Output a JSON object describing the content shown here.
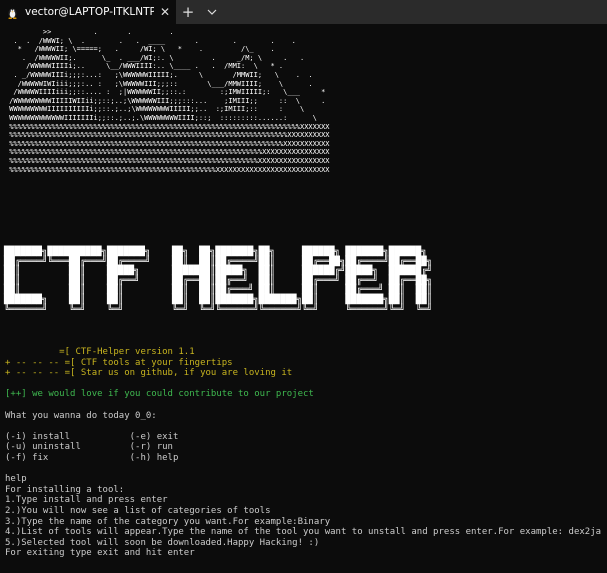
{
  "window": {
    "tab_title": "vector@LAPTOP-ITKLNTPG: /mi",
    "close_label": "✕",
    "new_tab_label": "+",
    "dropdown_label": "⌄"
  },
  "ascii_art": [
    "         >>          .       .         .",
    "  .  .  /WWWI; \\  .        .   .  ____       .        .        .    .",
    "   *   /WWWWII; \\=====;   .     /WI; \\   *    .         /\\_    .",
    "    .  /WWWWWII;.      \\_  . ___/WI;:. \\         .     _/M; \\     .   .",
    "     /WWWWWIIIIi;..     \\__/WWWIIII:.. \\____ .   .  /MMI:  \\   * .",
    "  . _/WWWWWIIIi;;;:...:   ;\\WWWWWWIIIII;.     \\       /MMWII;   \\    .  .",
    "   /WWWWWIWIiii;;;:.. :   ;\\WWWWWIII;;;::       \\___/MMWIIII;    \\      .",
    "  /WWWWWIIIIiii;;::.... :  ;|WWWWWWII;;::.:        :;IMWIIIII;:   \\___     *",
    " /WWWWWWWWWIIIIIWIIii;;::;..;\\WWWWWWIII;;;:::...    ;IMIII;;     ::  \\     .",
    " WWWWWWWWWIIIIIIIIIIi;;::.;..;\\WWWWWWWWIIIII;;..  :;IMIII;::     :    \\",
    " WWWWWWWWWWWWWIIIIIIIi;;::.;..;.\\WWWWWWWWIIII;::;  :::::::::......:      \\",
    " %%%%%%%%%%%%%%%%%%%%%%%%%%%%%%%%%%%%%%%%%%%%%%%%%%%%%%%%%%%%%%%%%%%%%XXXXXXX",
    " %%%%%%%%%%%%%%%%%%%%%%%%%%%%%%%%%%%%%%%%%%%%%%%%%%%%%%%%%%%%%%%%%%XXXXXXXXXX",
    " %%%%%%%%%%%%%%%%%%%%%%%%%%%%%%%%%%%%%%%%%%%%%%%%%%%%%%%%%%%%%%%%%XXXXXXXXXXX",
    " %%%%%%%%%%%%%%%%%%%%%%%%%%%%%%%%%%%%%%%%%%%%%%%%%%%%%%%%%%%%XXXXXXXXXXXXXXXX",
    " %%%%%%%%%%%%%%%%%%%%%%%%%%%%%%%%%%%%%%%%%%%%%%%%%%%%%%%%%%%XXXXXXXXXXXXXXXXX",
    " %%%%%%%%%%%%%%%%%%%%%%%%%%%%%%%%%%%%%%%%%%%%%%%%%XXXXXXXXXXXXXXXXXXXXXXXXXXX"
  ],
  "banner": [
    "███████╗██████████╗███████╗    ██╗  ██╗███████╗██╗     ██████╗ ███████╗██████╗ ",
    "██╔════╝╚═══██╔═══╝██╔════╝    ██║  ██║██╔════╝██║     ██╔══██╗██╔════╝██╔══██╗",
    "██║         ██║    █████╗      ███████║█████╗  ██║     ██████╔╝█████╗  ██████╔╝",
    "██║         ██║    ██╔══╝      ██╔══██║██╔══╝  ██║     ██╔═══╝ ██╔══╝  ██╔══██╗",
    "██║         ██║    ██║         ██║  ██║██╔═══╝ ██║     ██║     ██╔═══╝ ██║  ██║",
    "███████╗    ██║    ██║         ██║  ██║███████╗███████╗██║     ███████╗██║  ██║",
    "╚══════╝    ╚═╝    ╚═╝         ╚═╝  ╚═╝╚══════╝╚══════╝╚═╝     ╚══════╝╚═╝  ╚═╝"
  ],
  "info": {
    "version": "          =[ CTF-Helper version 1.1",
    "tools": "+ -- -- -- =[ CTF tools at your fingertips",
    "star": "+ -- -- -- =[ Star us on github, if you are loving it",
    "contribute": "[++] we would love if you could contribute to our project"
  },
  "prompt": "What you wanna do today 0_0:",
  "menu": [
    "(-i) install           (-e) exit",
    "(-u) uninstall         (-r) run",
    "(-f) fix               (-h) help"
  ],
  "help_output": [
    "help",
    "For installing a tool:",
    "1.Type install and press enter",
    "2.)You will now see a list of categories of tools",
    "3.)Type the name of the category you want.For example:Binary",
    "4.)List of tools will appear.Type the name of the tool you want to unstall and press enter.For example: dex2ja",
    "5.)Selected tool will soon be downloaded.Happy Hacking! :)",
    "For exiting type exit and hit enter"
  ]
}
